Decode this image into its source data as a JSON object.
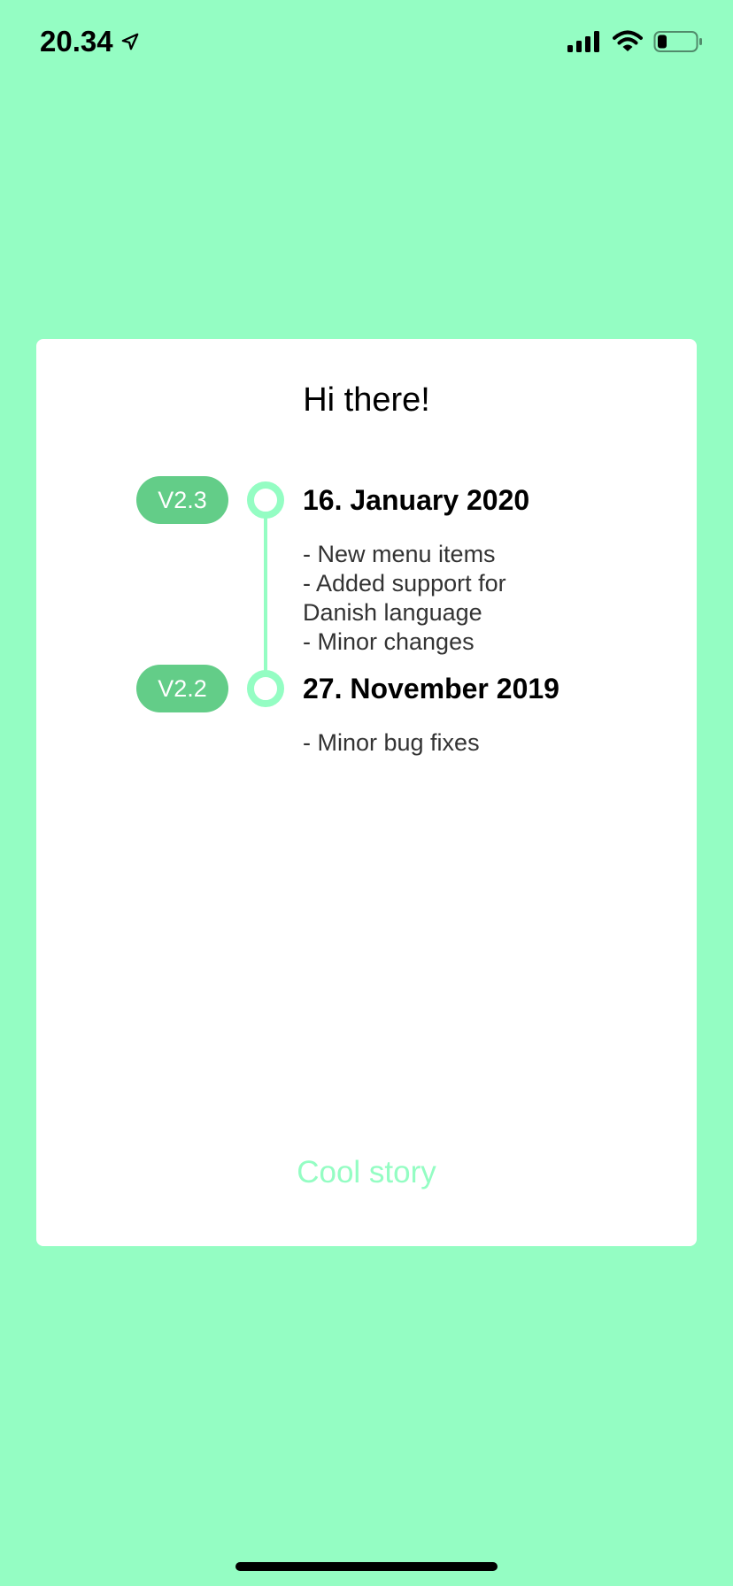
{
  "status_bar": {
    "time": "20.34",
    "icons": [
      "location-arrow-icon",
      "cellular-signal-icon",
      "wifi-icon",
      "battery-icon"
    ]
  },
  "card": {
    "title": "Hi there!",
    "entries": [
      {
        "version": "V2.3",
        "date": "16. January 2020",
        "notes": [
          "- New menu items",
          "- Added support for",
          "Danish language",
          "- Minor changes"
        ]
      },
      {
        "version": "V2.2",
        "date": "27. November 2019",
        "notes": [
          "- Minor bug fixes"
        ]
      }
    ],
    "button_label": "Cool story"
  },
  "colors": {
    "background": "#94fdc3",
    "card": "#ffffff",
    "badge": "#63cd88",
    "accent": "#94fdc3"
  }
}
